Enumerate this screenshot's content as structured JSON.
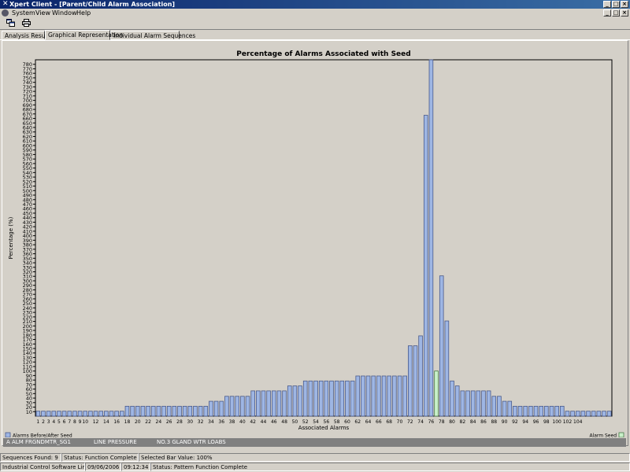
{
  "window": {
    "app_icon": "x-logo-icon",
    "title": "Xpert Client - [Parent/Child Alarm Association]",
    "buttons": {
      "minimize": "_",
      "maximize": "□",
      "close": "×"
    }
  },
  "menu": {
    "items": [
      "System",
      "View",
      "Window",
      "Help"
    ]
  },
  "toolbar": {
    "buttons": [
      {
        "icon": "windows-icon"
      },
      {
        "icon": "printer-icon"
      }
    ]
  },
  "tabs": [
    "Analysis Results",
    "Graphical Representation",
    "Individual Alarm Sequences"
  ],
  "active_tab": 1,
  "chart_data": {
    "type": "bar",
    "title": "Percentage of Alarms Associated with Seed",
    "xlabel": "Associated Alarms",
    "ylabel": "Percentage (%)",
    "ylim": [
      0,
      790
    ],
    "yticks": [
      10,
      20,
      30,
      40,
      50,
      60,
      70,
      80,
      90,
      100,
      110,
      120,
      130,
      140,
      150,
      160,
      170,
      180,
      190,
      200,
      210,
      220,
      230,
      240,
      250,
      260,
      270,
      280,
      290,
      300,
      310,
      320,
      330,
      340,
      350,
      360,
      370,
      380,
      390,
      400,
      410,
      420,
      430,
      440,
      450,
      460,
      470,
      480,
      490,
      500,
      510,
      520,
      530,
      540,
      550,
      560,
      570,
      580,
      590,
      600,
      610,
      620,
      630,
      640,
      650,
      660,
      670,
      680,
      690,
      700,
      710,
      720,
      730,
      740,
      750,
      760,
      770,
      780
    ],
    "xtick_labels": [
      "1",
      "2",
      "3",
      "4",
      "5",
      "6",
      "7",
      "8",
      "9",
      "10",
      "12",
      "14",
      "16",
      "18",
      "20",
      "22",
      "24",
      "26",
      "28",
      "30",
      "32",
      "34",
      "36",
      "38",
      "40",
      "42",
      "44",
      "46",
      "48",
      "50",
      "52",
      "54",
      "56",
      "58",
      "60",
      "62",
      "64",
      "66",
      "68",
      "70",
      "72",
      "74",
      "76",
      "78",
      "80",
      "82",
      "84",
      "86",
      "88",
      "90",
      "92",
      "94",
      "96",
      "98",
      "100",
      "102",
      "104"
    ],
    "categories": [
      1,
      2,
      3,
      4,
      5,
      6,
      7,
      8,
      9,
      10,
      11,
      12,
      13,
      14,
      15,
      16,
      17,
      18,
      19,
      20,
      21,
      22,
      23,
      24,
      25,
      26,
      27,
      28,
      29,
      30,
      31,
      32,
      33,
      34,
      35,
      36,
      37,
      38,
      39,
      40,
      41,
      42,
      43,
      44,
      45,
      46,
      47,
      48,
      49,
      50,
      51,
      52,
      53,
      54,
      55,
      56,
      57,
      58,
      59,
      60,
      61,
      62,
      63,
      64,
      65,
      66,
      67,
      68,
      69,
      70,
      71,
      72,
      73,
      74,
      75,
      76,
      77,
      78,
      79,
      80,
      81,
      82,
      83,
      84,
      85,
      86,
      87,
      88,
      89,
      90,
      91,
      92,
      93,
      94,
      95,
      96,
      97,
      98,
      99,
      100,
      101,
      102,
      103,
      104,
      105
    ],
    "values": [
      11,
      11,
      11,
      11,
      11,
      11,
      11,
      11,
      11,
      11,
      11,
      11,
      11,
      11,
      11,
      11,
      11,
      22,
      22,
      22,
      22,
      22,
      22,
      22,
      22,
      22,
      22,
      22,
      22,
      22,
      22,
      22,
      22,
      33,
      33,
      33,
      44,
      44,
      44,
      44,
      44,
      56,
      56,
      56,
      56,
      56,
      56,
      56,
      67,
      67,
      67,
      78,
      78,
      78,
      78,
      78,
      78,
      78,
      78,
      78,
      78,
      89,
      89,
      89,
      89,
      89,
      89,
      89,
      89,
      89,
      89,
      156,
      156,
      178,
      667,
      790,
      100,
      311,
      211,
      78,
      67,
      56,
      56,
      56,
      56,
      56,
      56,
      44,
      44,
      33,
      33,
      22,
      22,
      22,
      22,
      22,
      22,
      22,
      22,
      22,
      22,
      11,
      11,
      11,
      11,
      11,
      11,
      11,
      11,
      11
    ],
    "seed_index": 76,
    "legend": [
      {
        "label": "Alarms Before/After Seed",
        "color": "#9eb6e4"
      },
      {
        "label": "Alarm Seed",
        "color": "#c8f0c8"
      }
    ],
    "grid": false
  },
  "seed_info": {
    "tag": "A ALM FRGNDMTR_SG1",
    "parameter": "LINE PRESSURE",
    "description": "NO.3 GLAND WTR   LOABS"
  },
  "status": {
    "row1": [
      "Sequences Found: 9",
      "Status: Function Complete",
      "Selected Bar Value: 100%"
    ],
    "row2": [
      "Industrial Control Software Limited",
      "09/06/2006",
      "09:12:34",
      "Status: Pattern Function Complete"
    ]
  },
  "colors": {
    "titlebar": "#0a246a",
    "bar": "#9eb6e4",
    "bar_border": "#4a5a8a",
    "seed_bar": "#c8f0c8",
    "panel": "#d4d0c8"
  }
}
